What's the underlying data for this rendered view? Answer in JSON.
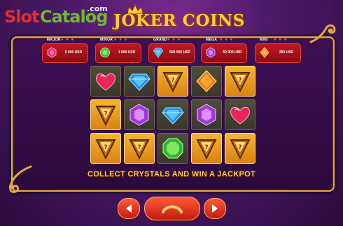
{
  "watermark": {
    "part1": "Slot",
    "part2": "Catalog",
    "suffix": ".com"
  },
  "game": {
    "title": "JOKER COINS"
  },
  "jackpots": [
    {
      "name": "MAJOR",
      "amount": "5 000 USD",
      "gem": "ruby"
    },
    {
      "name": "MINOR",
      "amount": "1 000 USD",
      "gem": "emerald"
    },
    {
      "name": "GRAND",
      "amount": "500 000 USD",
      "gem": "sapphire"
    },
    {
      "name": "MEGA",
      "amount": "50 000 USD",
      "gem": "amethyst"
    },
    {
      "name": "MINI",
      "amount": "250 USD",
      "gem": "topaz"
    }
  ],
  "grid": [
    [
      "heart-ruby",
      "sapphire",
      "joker-triangle",
      "topaz-diamond",
      "joker-triangle"
    ],
    [
      "joker-triangle",
      "amethyst",
      "sapphire",
      "amethyst",
      "heart-ruby"
    ],
    [
      "joker-triangle",
      "joker-triangle",
      "emerald",
      "joker-triangle",
      "joker-triangle"
    ]
  ],
  "tagline": "COLLECT CRYSTALS AND WIN A JACKPOT",
  "colors": {
    "accent": "#ffc83a",
    "jackpot_bg": "#c41722",
    "button": "#e0301f"
  },
  "controls": [
    "arrow-left-icon",
    "back-icon",
    "arrow-right-icon"
  ]
}
